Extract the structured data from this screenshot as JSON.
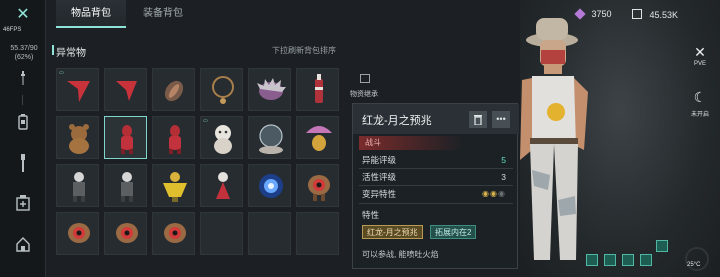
{
  "rail": {
    "fps_label": "46FPS",
    "capacity": "55.37/90",
    "capacity_pct": "(62%)"
  },
  "tabs": [
    {
      "label": "物品背包",
      "active": true
    },
    {
      "label": "装备背包",
      "active": false
    }
  ],
  "section": {
    "title": "异常物",
    "sort_hint": "下拉刷新背包排序"
  },
  "currency": {
    "gems": "3750",
    "coins": "45.53K"
  },
  "inherit": {
    "label": "物资继承"
  },
  "detail": {
    "name": "红龙-月之预兆",
    "category": "战斗",
    "stats": [
      {
        "label": "异能评级",
        "value": "5"
      },
      {
        "label": "活性评级",
        "value": "3"
      },
      {
        "label": "变异特性",
        "value": ""
      }
    ],
    "traits_label": "特性",
    "traits": [
      "红龙-月之预兆",
      "拓展内在2"
    ],
    "description": "可以参战, 能喷吐火焰"
  },
  "right_rail": {
    "pve_label": "PVE",
    "night_label": "未开启",
    "temperature": "25°C"
  },
  "colors": {
    "accent": "#8fe3d6",
    "selected_border": "#7fd6cc",
    "stat_highlight": "#5fe0c8",
    "combat_red": "#7a2b2b",
    "trait_gold": "#b79b54",
    "trait_teal": "#2f6b63"
  }
}
